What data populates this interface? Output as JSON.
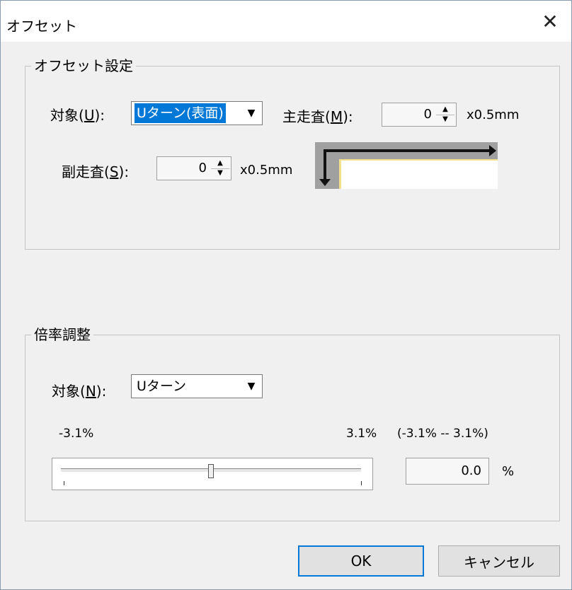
{
  "window": {
    "title": "オフセット",
    "close_glyph": "✕"
  },
  "offset_group": {
    "legend": "オフセット設定",
    "target_label_pre": "対象(",
    "target_label_key": "U",
    "target_label_post": "):",
    "target_value": "Uターン(表面)",
    "main_scan_label_pre": "主走査(",
    "main_scan_label_key": "M",
    "main_scan_label_post": "):",
    "main_scan_value": "0",
    "main_unit": "x0.5mm",
    "sub_scan_label_pre": "副走査(",
    "sub_scan_label_key": "S",
    "sub_scan_label_post": "):",
    "sub_scan_value": "0",
    "sub_unit": "x0.5mm"
  },
  "scale_group": {
    "legend": "倍率調整",
    "target_label_pre": "対象(",
    "target_label_key": "N",
    "target_label_post": "):",
    "target_value": "Uターン",
    "min_label": "-3.1%",
    "max_label": "3.1%",
    "range_label": "(-3.1% -- 3.1%)",
    "slider_value": 0.0,
    "value": "0.0",
    "unit": "%"
  },
  "buttons": {
    "ok": "OK",
    "cancel": "キャンセル"
  },
  "icons": {
    "spin_up": "▲",
    "spin_down": "▼",
    "dropdown": "▼"
  },
  "colors": {
    "selection": "#0078d7",
    "dialog_bg": "#f0f0f0",
    "paper_edge": "#f2e18c"
  }
}
